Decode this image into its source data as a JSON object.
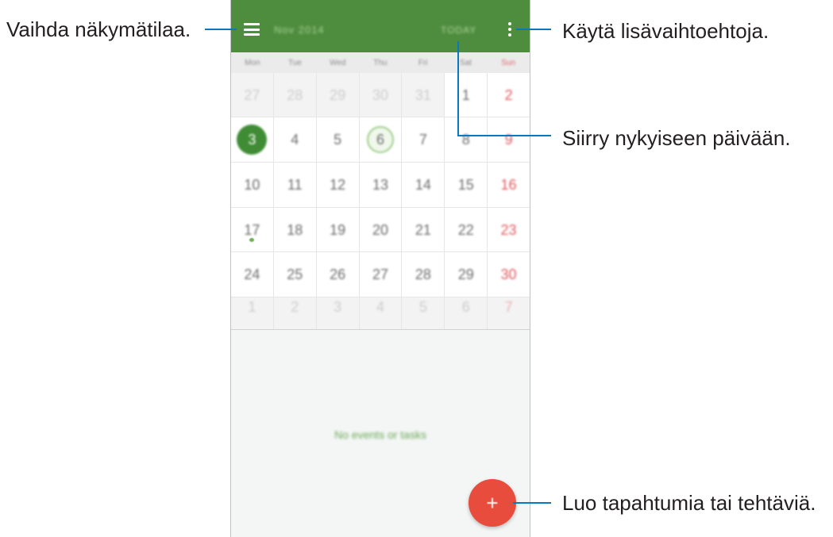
{
  "callouts": {
    "change_view": "Vaihda näkymätilaa.",
    "more_options": "Käytä lisävaihtoehtoja.",
    "go_to_today": "Siirry nykyiseen päivään.",
    "create_item": "Luo tapahtumia tai tehtäviä."
  },
  "calendar": {
    "month_label": "Nov 2014",
    "today_button": "TODAY",
    "menu_icon": "hamburger-menu-icon",
    "more_icon": "more-options-icon",
    "weekdays": [
      "Mon",
      "Tue",
      "Wed",
      "Thu",
      "Fri",
      "Sat",
      "Sun"
    ],
    "weeks": [
      [
        {
          "day": "27",
          "other_month": true
        },
        {
          "day": "28",
          "other_month": true
        },
        {
          "day": "29",
          "other_month": true
        },
        {
          "day": "30",
          "other_month": true
        },
        {
          "day": "31",
          "other_month": true
        },
        {
          "day": "1"
        },
        {
          "day": "2",
          "sunday": true
        }
      ],
      [
        {
          "day": "3",
          "selected": true
        },
        {
          "day": "4"
        },
        {
          "day": "5"
        },
        {
          "day": "6",
          "today": true
        },
        {
          "day": "7"
        },
        {
          "day": "8"
        },
        {
          "day": "9",
          "sunday": true
        }
      ],
      [
        {
          "day": "10"
        },
        {
          "day": "11"
        },
        {
          "day": "12"
        },
        {
          "day": "13"
        },
        {
          "day": "14"
        },
        {
          "day": "15"
        },
        {
          "day": "16",
          "sunday": true
        }
      ],
      [
        {
          "day": "17",
          "has_event": true
        },
        {
          "day": "18"
        },
        {
          "day": "19"
        },
        {
          "day": "20"
        },
        {
          "day": "21"
        },
        {
          "day": "22"
        },
        {
          "day": "23",
          "sunday": true
        }
      ],
      [
        {
          "day": "24"
        },
        {
          "day": "25"
        },
        {
          "day": "26"
        },
        {
          "day": "27"
        },
        {
          "day": "28"
        },
        {
          "day": "29"
        },
        {
          "day": "30",
          "sunday": true
        }
      ],
      [
        {
          "day": "1",
          "other_month": true
        },
        {
          "day": "2",
          "other_month": true
        },
        {
          "day": "3",
          "other_month": true
        },
        {
          "day": "4",
          "other_month": true
        },
        {
          "day": "5",
          "other_month": true
        },
        {
          "day": "6",
          "other_month": true
        },
        {
          "day": "7",
          "other_month": true,
          "sunday": true
        }
      ]
    ],
    "empty_message": "No events or tasks",
    "add_button": {
      "icon": "plus-icon",
      "label": "+"
    }
  },
  "colors": {
    "header_green": "#4e8c3e",
    "selected_green": "#3f8c35",
    "add_button_red": "#e84c3d",
    "sunday_red": "#e0575b",
    "callout_line_blue": "#0a78be"
  }
}
